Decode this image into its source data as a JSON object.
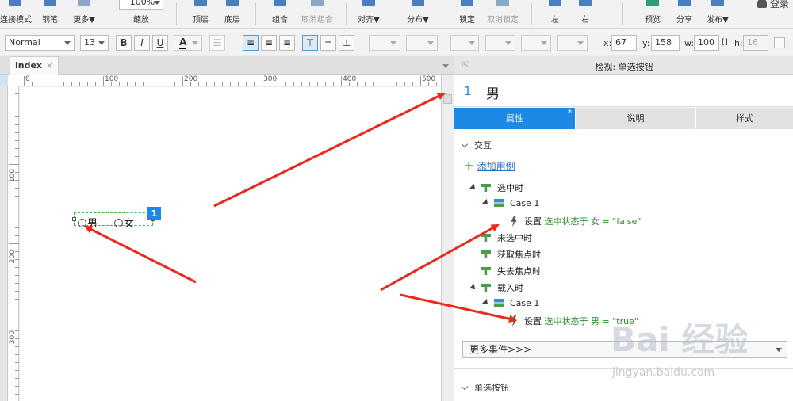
{
  "toolbar1": {
    "tools": [
      "连接模式",
      "钢笔",
      "更多▼",
      "缩放",
      "顶层",
      "底层",
      "组合",
      "取消组合",
      "对齐▼",
      "分布▼",
      "锁定",
      "取消锁定",
      "左",
      "右",
      "预览",
      "分享",
      "发布▼"
    ],
    "zoom_value": "100%",
    "login_label": "登录"
  },
  "toolbar2": {
    "font_style": "Normal",
    "font_size": "13",
    "bold": "B",
    "italic": "I",
    "underline": "U",
    "font_color": "A",
    "x_label": "x:",
    "x_value": "67",
    "y_label": "y:",
    "y_value": "158",
    "w_label": "w:",
    "w_value": "100",
    "h_label": "h:",
    "h_value": "16"
  },
  "tabs": [
    {
      "label": "index",
      "close": "×"
    }
  ],
  "ruler": {
    "top_labels": [
      "0",
      "100",
      "200",
      "300",
      "400",
      "500"
    ],
    "left_labels": [
      "100",
      "200",
      "300"
    ]
  },
  "canvas": {
    "radio_male": "男",
    "radio_female": "女",
    "badge": "1"
  },
  "inspector": {
    "title": "检视: 单选按钮",
    "index": "1",
    "name": "男",
    "tabs": [
      "属性",
      "说明",
      "样式"
    ],
    "tab_marker": "*",
    "section_interaction": "交互",
    "add_case": "添加用例",
    "events": [
      {
        "label": "选中时"
      },
      {
        "label": "Case 1"
      },
      {
        "prefix": "设置 ",
        "action": "选中状态于 女 = \"false\""
      },
      {
        "label": "未选中时"
      },
      {
        "label": "获取焦点时"
      },
      {
        "label": "失去焦点时"
      },
      {
        "label": "载入时"
      },
      {
        "label": "Case 1"
      },
      {
        "prefix": "设置 ",
        "action": "选中状态于 男 = \"true\""
      }
    ],
    "more_events": "更多事件>>>",
    "section_radio": "单选按钮"
  },
  "watermark": {
    "main": "Bai 经验",
    "sub": "jingyan.baidu.com"
  },
  "colors": {
    "accent": "#1e88e5",
    "annotation_arrow": "#e8291c",
    "action_green": "#2b8a2b"
  }
}
